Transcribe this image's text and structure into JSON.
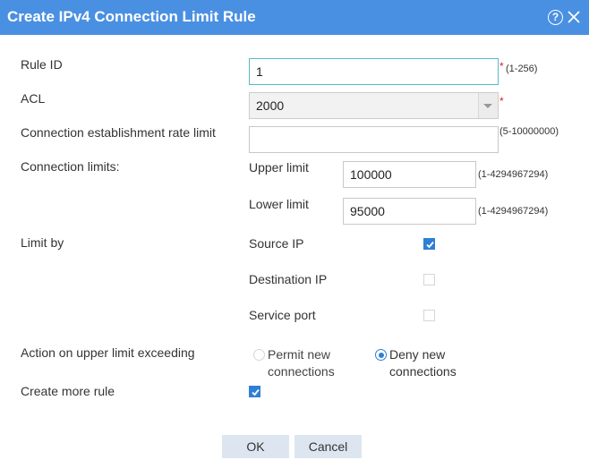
{
  "dialog": {
    "title": "Create IPv4 Connection Limit Rule",
    "help_glyph": "?",
    "accent_color": "#4a90e2"
  },
  "rule_id": {
    "label": "Rule ID",
    "value": "1",
    "required_mark": "*",
    "hint": "(1-256)"
  },
  "acl": {
    "label": "ACL",
    "value": "2000",
    "required_mark": "*"
  },
  "rate_limit": {
    "label": "Connection establishment rate limit",
    "value": "",
    "hint": "(5-10000000)"
  },
  "connection_limits": {
    "label": "Connection limits:",
    "upper": {
      "label": "Upper limit",
      "value": "100000",
      "hint": "(1-4294967294)"
    },
    "lower": {
      "label": "Lower limit",
      "value": "95000",
      "hint": "(1-4294967294)"
    }
  },
  "limit_by": {
    "label": "Limit by",
    "options": [
      {
        "label": "Source IP",
        "checked": true
      },
      {
        "label": "Destination IP",
        "checked": false
      },
      {
        "label": "Service port",
        "checked": false
      }
    ]
  },
  "action": {
    "label": "Action on upper limit exceeding",
    "options": [
      {
        "label": "Permit new connections",
        "selected": false
      },
      {
        "label": "Deny new connections",
        "selected": true
      }
    ]
  },
  "create_more": {
    "label": "Create more rule",
    "checked": true
  },
  "buttons": {
    "ok": "OK",
    "cancel": "Cancel"
  }
}
